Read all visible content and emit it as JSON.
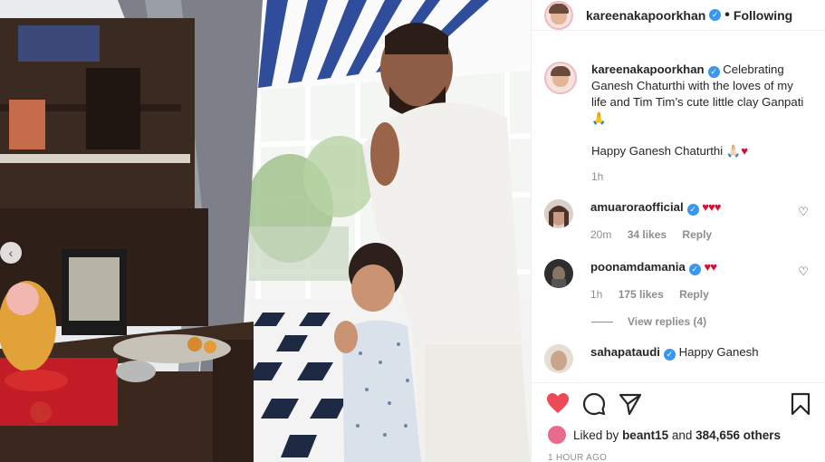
{
  "post": {
    "username": "kareenakapoorkhan",
    "follow_label": "Following",
    "separator": "•"
  },
  "caption": {
    "username": "kareenakapoorkhan",
    "text": "Celebrating Ganesh Chaturthi with the loves of my life and Tim Tim’s cute little clay Ganpati 🙏",
    "line2": "Happy Ganesh Chaturthi",
    "line2_emoji": "♥",
    "time": "1h"
  },
  "comments": [
    {
      "username": "amuaroraofficial",
      "text": "♥♥♥",
      "time": "20m",
      "likes": "34 likes",
      "reply": "Reply"
    },
    {
      "username": "poonamdamania",
      "text": "♥♥",
      "time": "1h",
      "likes": "175 likes",
      "reply": "Reply"
    }
  ],
  "view_replies": "View replies (4)",
  "partial_comment": {
    "username": "sahapataudi",
    "text": "Happy Ganesh"
  },
  "likes": {
    "liked_by_label": "Liked by",
    "liker": "beant15",
    "and_label": "and",
    "others": "384,656 others"
  },
  "timestamp": "1 HOUR AGO",
  "colors": {
    "verified": "#3897f0",
    "like_red": "#ed4956",
    "meta_gray": "#8e8e8e"
  },
  "icons": [
    "chevron-left-icon",
    "verified-icon",
    "heart-icon",
    "comment-icon",
    "share-icon",
    "bookmark-icon"
  ]
}
